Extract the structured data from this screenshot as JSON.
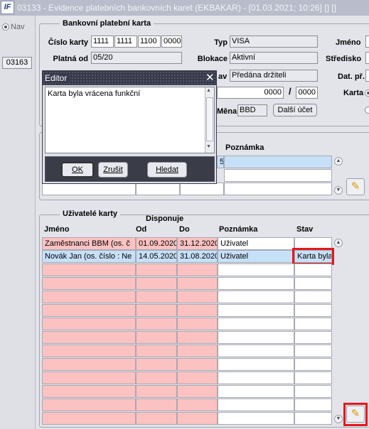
{
  "window": {
    "app_logo": "IF",
    "title": "03133 - Evidence platebních bankovních karet (EKBAKAR) - [01.03.2021; 10:26]  []  []"
  },
  "left_panel": {
    "radio_label": "Nav",
    "code": "03163"
  },
  "card_section": {
    "legend": "Bankovní platební karta",
    "card_number_label": "Číslo karty",
    "card_number": [
      "1111",
      "1111",
      "1100",
      "0000"
    ],
    "valid_from_label": "Platná od",
    "valid_from": "05/20",
    "type_label": "Typ",
    "type": "VISA",
    "blocking_label": "Blokace",
    "blocking": "Aktivní",
    "state_label_partial": "av",
    "state": "Předána držiteli",
    "amount_1": "0000",
    "amount_sep": "/",
    "amount_2": "0000",
    "currency_label_partial": "Měna",
    "currency": "BBD",
    "next_account_button": "Další účet",
    "name_label": "Jméno",
    "center_label": "Středisko",
    "date_label": "Dat. př.",
    "card_label": "Karta"
  },
  "notes_table": {
    "partial_cell": "5",
    "header_note": "Poznámka"
  },
  "users_section": {
    "legend": "Uživatelé karty",
    "headers": {
      "disposes": "Disponuje",
      "name": "Jméno",
      "from": "Od",
      "to": "Do",
      "note": "Poznámka",
      "state": "Stav"
    },
    "rows": [
      {
        "name": "Zaměstnanci BBM    (os. č",
        "from": "01.09.2020",
        "to": "31.12.2020",
        "note": "Uživatel",
        "state": ""
      },
      {
        "name": "Novák Jan   (os. číslo : Ne",
        "from": "14.05.2020",
        "to": "31.08.2020",
        "note": "Uživatel",
        "state": "Karta byla"
      }
    ],
    "empty_rows": 12
  },
  "editor_dialog": {
    "title": "Editor",
    "text": "Karta byla vrácena funkční",
    "ok_button": "OK",
    "cancel_button": "Zrušit",
    "search_button": "Hledat"
  },
  "icons": {
    "edit": "pencil-icon",
    "close": "close-icon"
  },
  "colors": {
    "highlight": "#e3191f",
    "title_bar": "#b8bccb",
    "dialog_bar": "#363a4b",
    "pink_cell": "#fcc2c2",
    "selected_cell": "#c6e0f7"
  }
}
